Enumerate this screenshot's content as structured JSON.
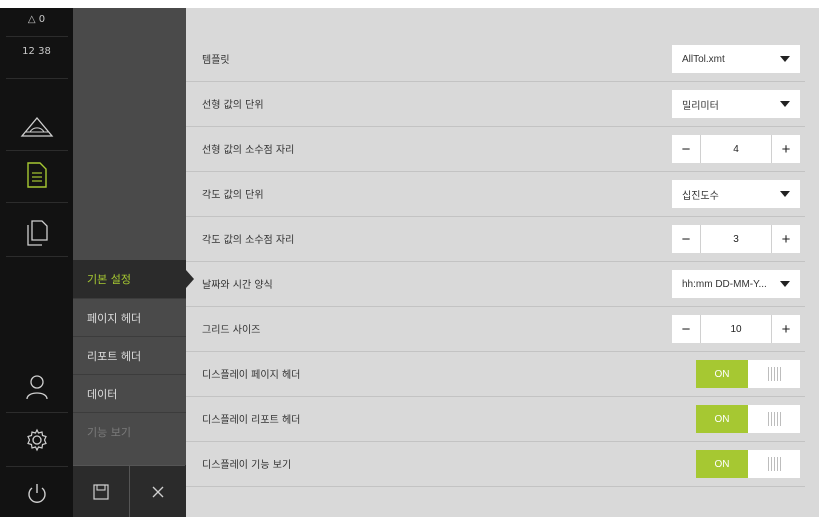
{
  "status": {
    "warnings": "0",
    "clock": "12 38"
  },
  "rail_icons": [
    "warning-triangle-icon",
    "measure-icon",
    "document-icon",
    "files-icon",
    "user-icon",
    "settings-gear-icon",
    "power-icon"
  ],
  "submenu": {
    "items": [
      {
        "label": "기본 설정",
        "state": "active"
      },
      {
        "label": "페이지 헤더",
        "state": "normal"
      },
      {
        "label": "리포트 헤더",
        "state": "normal"
      },
      {
        "label": "데이터",
        "state": "normal"
      },
      {
        "label": "기능 보기",
        "state": "disabled"
      }
    ],
    "buttons": [
      "save-icon",
      "close-icon"
    ]
  },
  "settings": {
    "rows": [
      {
        "label": "템플릿",
        "control": "dropdown",
        "value": "AllTol.xmt"
      },
      {
        "label": "선형 값의 단위",
        "control": "dropdown",
        "value": "밀리미터"
      },
      {
        "label": "선형 값의 소수점 자리",
        "control": "stepper",
        "value": "4"
      },
      {
        "label": "각도 값의 단위",
        "control": "dropdown",
        "value": "십진도수"
      },
      {
        "label": "각도 값의 소수점 자리",
        "control": "stepper",
        "value": "3"
      },
      {
        "label": "날짜와 시간 양식",
        "control": "dropdown",
        "value": "hh:mm DD-MM-Y..."
      },
      {
        "label": "그리드 사이즈",
        "control": "stepper",
        "value": "10"
      },
      {
        "label": "디스플레이 페이지 헤더",
        "control": "toggle",
        "value": "ON"
      },
      {
        "label": "디스플레이 리포트 헤더",
        "control": "toggle",
        "value": "ON"
      },
      {
        "label": "디스플레이 기능 보기",
        "control": "toggle",
        "value": "ON"
      }
    ],
    "stepper_minus": "−",
    "stepper_plus": "+"
  },
  "colors": {
    "accent": "#a6c832",
    "rail": "#121212",
    "submenu": "#4a4a4a",
    "content": "#d9d9d9"
  }
}
